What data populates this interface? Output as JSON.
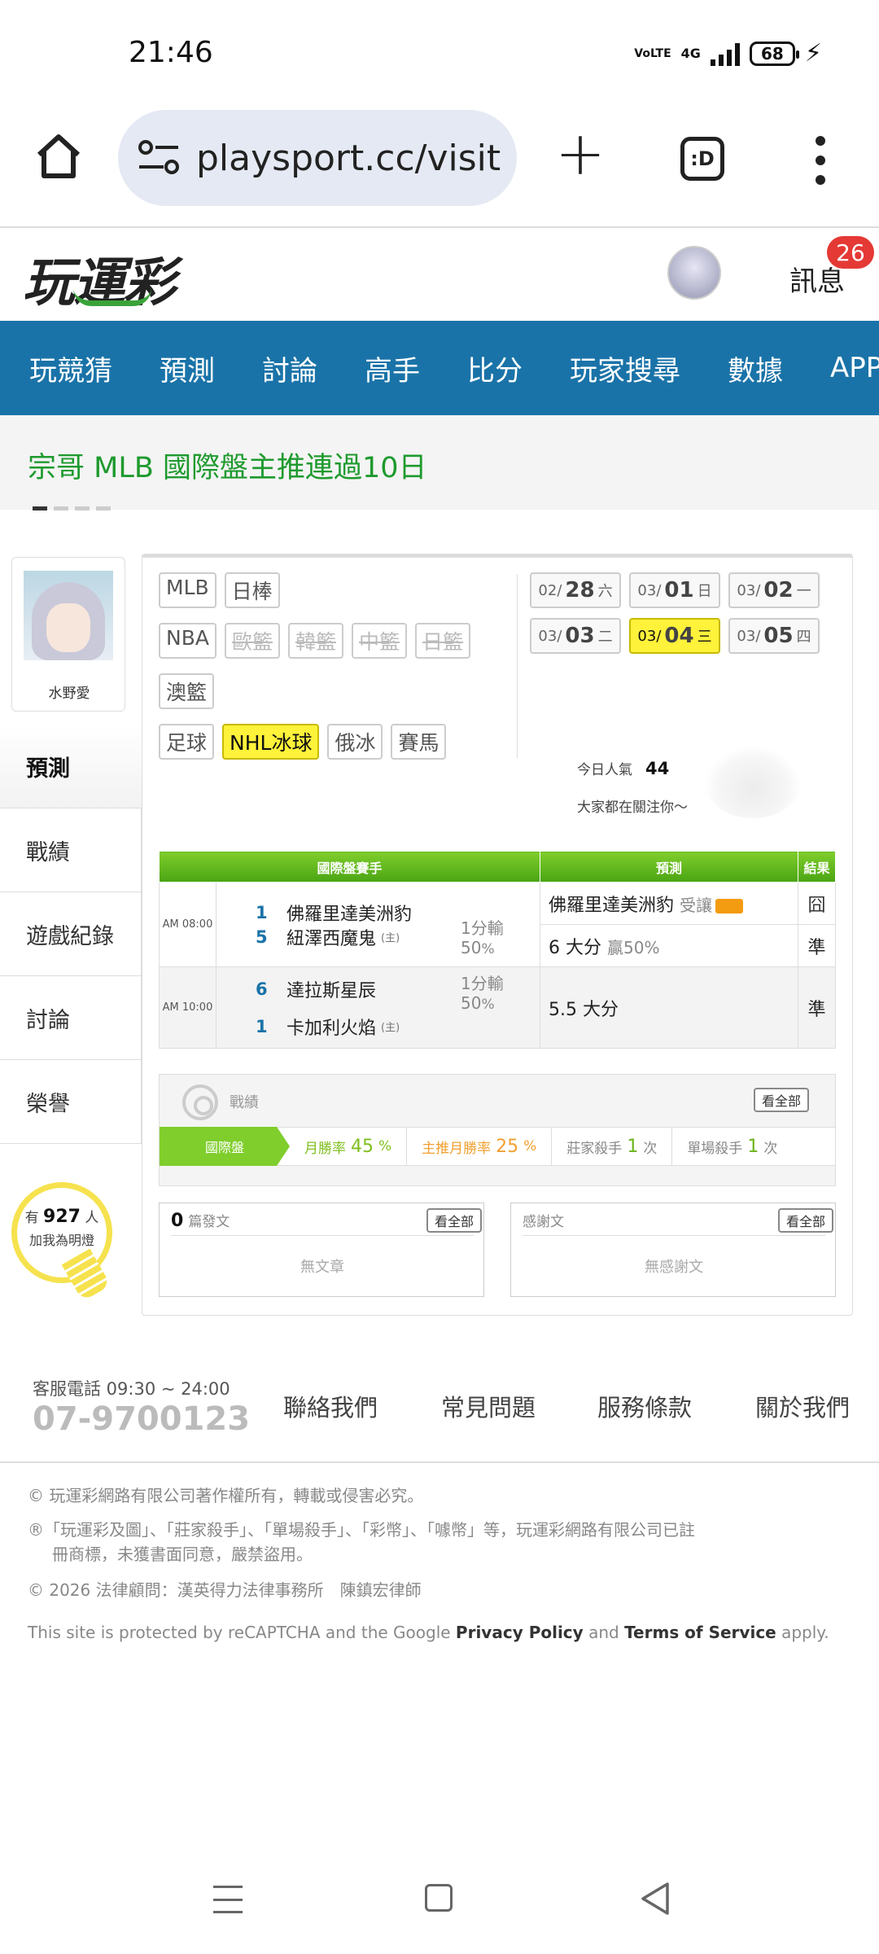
{
  "status": {
    "time": "21:46",
    "network": "4G",
    "volte": "VoLTE",
    "battery": "68"
  },
  "browser": {
    "url": "playsport.cc/visit",
    "tabs_label": ":D"
  },
  "header": {
    "logo": "玩運彩",
    "message_label": "訊息",
    "badge": "26"
  },
  "nav": {
    "items": [
      "玩競猜",
      "預測",
      "討論",
      "高手",
      "比分",
      "玩家搜尋",
      "數據",
      "APP"
    ]
  },
  "banner": {
    "text": "宗哥 MLB 國際盤主推連過10日"
  },
  "profile": {
    "name": "水野愛"
  },
  "side_menu": [
    "預測",
    "戰績",
    "遊戲紀錄",
    "討論",
    "榮譽"
  ],
  "fans": {
    "prefix": "有",
    "count": "927",
    "suffix": "人",
    "line2": "加我為明燈"
  },
  "leagues": {
    "row1": [
      "MLB",
      "日棒"
    ],
    "row2": [
      "NBA",
      "歐籃",
      "韓籃",
      "中籃",
      "日籃"
    ],
    "row3": [
      "澳籃"
    ],
    "row4": [
      "足球",
      "NHL冰球",
      "俄冰",
      "賽馬"
    ]
  },
  "dates": [
    {
      "mon": "02/",
      "day": "28",
      "wd": "六"
    },
    {
      "mon": "03/",
      "day": "01",
      "wd": "日"
    },
    {
      "mon": "03/",
      "day": "02",
      "wd": "一"
    },
    {
      "mon": "03/",
      "day": "03",
      "wd": "二"
    },
    {
      "mon": "03/",
      "day": "04",
      "wd": "三"
    },
    {
      "mon": "03/",
      "day": "05",
      "wd": "四"
    }
  ],
  "popularity": {
    "label": "今日人氣",
    "value": "44",
    "sub": "大家都在關注你～"
  },
  "table": {
    "headers": [
      "國際盤賽手",
      "預測",
      "結果"
    ],
    "games": [
      {
        "time": "AM 08:00",
        "team1_no": "1",
        "team1": "佛羅里達美洲豹",
        "team2_no": "5",
        "team2": "紐澤西魔鬼",
        "home_mark": "(主)",
        "spread": "1分輸",
        "pct": "50",
        "pred1": "佛羅里達美洲豹",
        "pred1_tail": "受讓",
        "res1": "囧",
        "pred2": "6 大分",
        "pred2_tail": "贏50%",
        "res2": "準"
      },
      {
        "time": "AM 10:00",
        "team1_no": "6",
        "team1": "達拉斯星辰",
        "team2_no": "1",
        "team2": "卡加利火焰",
        "home_mark": "(主)",
        "spread": "1分輸",
        "pct": "50",
        "pred": "5.5 大分",
        "res": "準"
      }
    ],
    "pct_unit": "%"
  },
  "record": {
    "title": "戰績",
    "all": "看全部",
    "lead": "國際盤",
    "monthly_label": "月勝率",
    "monthly": "45",
    "main_label": "主推月勝率",
    "main": "25",
    "killer_label": "莊家殺手",
    "killer": "1",
    "killer_unit": "次",
    "single_label": "單場殺手",
    "single": "1",
    "single_unit": "次",
    "pct": "%"
  },
  "posts": {
    "count": "0",
    "label": "篇發文",
    "all": "看全部",
    "empty": "無文章"
  },
  "thanks": {
    "label": "感謝文",
    "all": "看全部",
    "empty": "無感謝文"
  },
  "footer": {
    "phone_label": "客服電話 09:30 ~ 24:00",
    "phone": "07-9700123",
    "links": [
      "聯絡我們",
      "常見問題",
      "服務條款",
      "關於我們"
    ],
    "copy1": "© 玩運彩網路有限公司著作權所有，轉載或侵害必究。",
    "copy2a": "®「玩運彩及圖」、「莊家殺手」、「單場殺手」、「彩幣」、「噱幣」等，玩運彩網路有限公司已註",
    "copy2b": "冊商標，未獲書面同意，嚴禁盜用。",
    "copy3": "© 2026 法律顧問：漢英得力法律事務所　陳鎮宏律師",
    "captcha_a": "This site is protected by reCAPTCHA and the Google",
    "privacy": "Privacy Policy",
    "and": "and",
    "terms": "Terms of Service",
    "apply": "apply."
  },
  "colors": {
    "nav": "#1a73a8",
    "green": "#1e9a2e",
    "highlight": "#fff23a",
    "badge": "#e53935"
  }
}
